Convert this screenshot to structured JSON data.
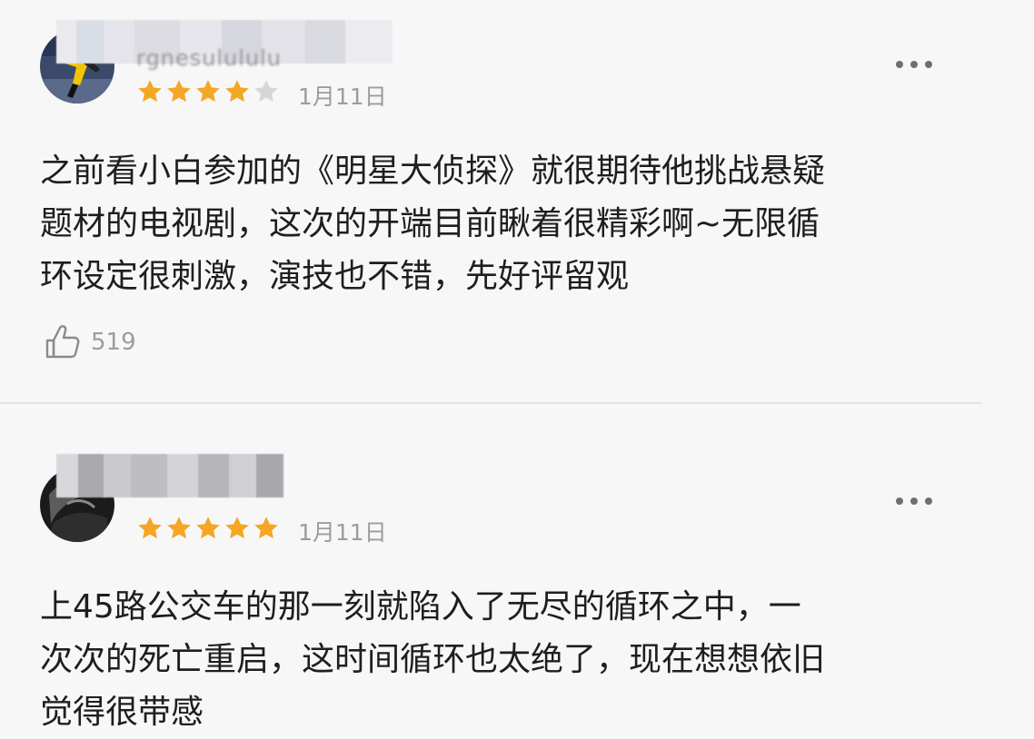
{
  "colors": {
    "background": "#f7f7f8",
    "star_filled": "#f5a623",
    "star_empty": "#d6d6d6",
    "text_primary": "#1e1e1e",
    "text_secondary": "#9c9c9c"
  },
  "reviews": [
    {
      "username": "rgnesulululu",
      "rating": 4,
      "rating_max": 5,
      "date": "1月11日",
      "lines": [
        "之前看小白参加的《明星大侦探》就很期待他挑战悬疑",
        "题材的电视剧，这次的开端目前瞅着很精彩啊~无限循",
        "环设定很刺激，演技也不错，先好评留观"
      ],
      "likes": "519",
      "icons": {
        "like": "thumbs-up-icon",
        "more": "more-dots-icon",
        "star": "star-icon"
      }
    },
    {
      "username": "",
      "rating": 5,
      "rating_max": 5,
      "date": "1月11日",
      "lines": [
        "上45路公交车的那一刻就陷入了无尽的循环之中，一",
        "次次的死亡重启，这时间循环也太绝了，现在想想依旧",
        "觉得很带感"
      ],
      "icons": {
        "more": "more-dots-icon",
        "star": "star-icon"
      }
    }
  ]
}
